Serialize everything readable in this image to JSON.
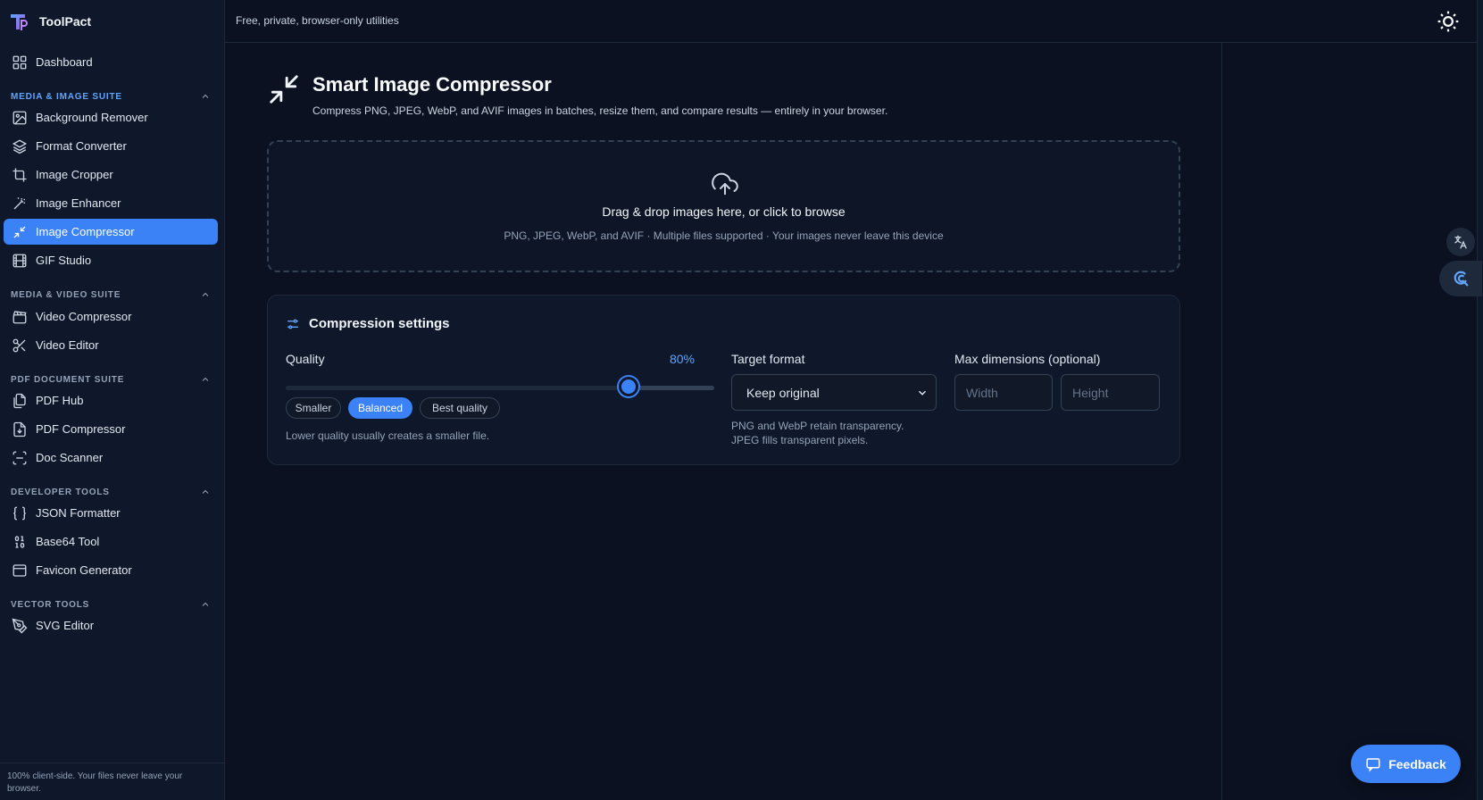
{
  "app": {
    "name": "ToolPact",
    "tagline": "Free, private, browser-only utilities"
  },
  "sidebar": {
    "dashboard": "Dashboard",
    "sections": [
      {
        "title": "MEDIA & IMAGE SUITE",
        "items": [
          "Background Remover",
          "Format Converter",
          "Image Cropper",
          "Image Enhancer",
          "Image Compressor",
          "GIF Studio"
        ]
      },
      {
        "title": "MEDIA & VIDEO SUITE",
        "items": [
          "Video Compressor",
          "Video Editor"
        ]
      },
      {
        "title": "PDF DOCUMENT SUITE",
        "items": [
          "PDF Hub",
          "PDF Compressor",
          "Doc Scanner"
        ]
      },
      {
        "title": "DEVELOPER TOOLS",
        "items": [
          "JSON Formatter",
          "Base64 Tool",
          "Favicon Generator"
        ]
      },
      {
        "title": "VECTOR TOOLS",
        "items": [
          "SVG Editor"
        ]
      }
    ],
    "active_item": "Image Compressor",
    "footer": "100% client-side. Your files never leave your browser."
  },
  "page": {
    "title": "Smart Image Compressor",
    "subtitle": "Compress PNG, JPEG, WebP, and AVIF images in batches, resize them, and compare results — entirely in your browser."
  },
  "dropzone": {
    "title": "Drag & drop images here, or click to browse",
    "subtitle": "PNG, JPEG, WebP, and AVIF · Multiple files supported · Your images never leave this device"
  },
  "settings": {
    "title": "Compression settings",
    "quality": {
      "label": "Quality",
      "value": 80,
      "value_text": "80%",
      "presets": [
        "Smaller",
        "Balanced",
        "Best quality"
      ],
      "active_preset": "Balanced",
      "hint": "Lower quality usually creates a smaller file."
    },
    "format": {
      "label": "Target format",
      "selected": "Keep original",
      "hint_line1": "PNG and WebP retain transparency.",
      "hint_line2": "JPEG fills transparent pixels."
    },
    "dimensions": {
      "label": "Max dimensions (optional)",
      "width_placeholder": "Width",
      "height_placeholder": "Height"
    }
  },
  "feedback_label": "Feedback",
  "colors": {
    "accent": "#3b82f6",
    "background": "#0b1120",
    "sidebar": "#0f172a"
  },
  "icons": {
    "brand": "toolpact-logo",
    "theme": "sun-icon",
    "translate": "translate-icon",
    "assistant": "assistant-icon",
    "feedback": "chat-icon",
    "upload": "cloud-upload-icon",
    "compress": "compress-arrows-icon",
    "settings": "sliders-icon"
  }
}
